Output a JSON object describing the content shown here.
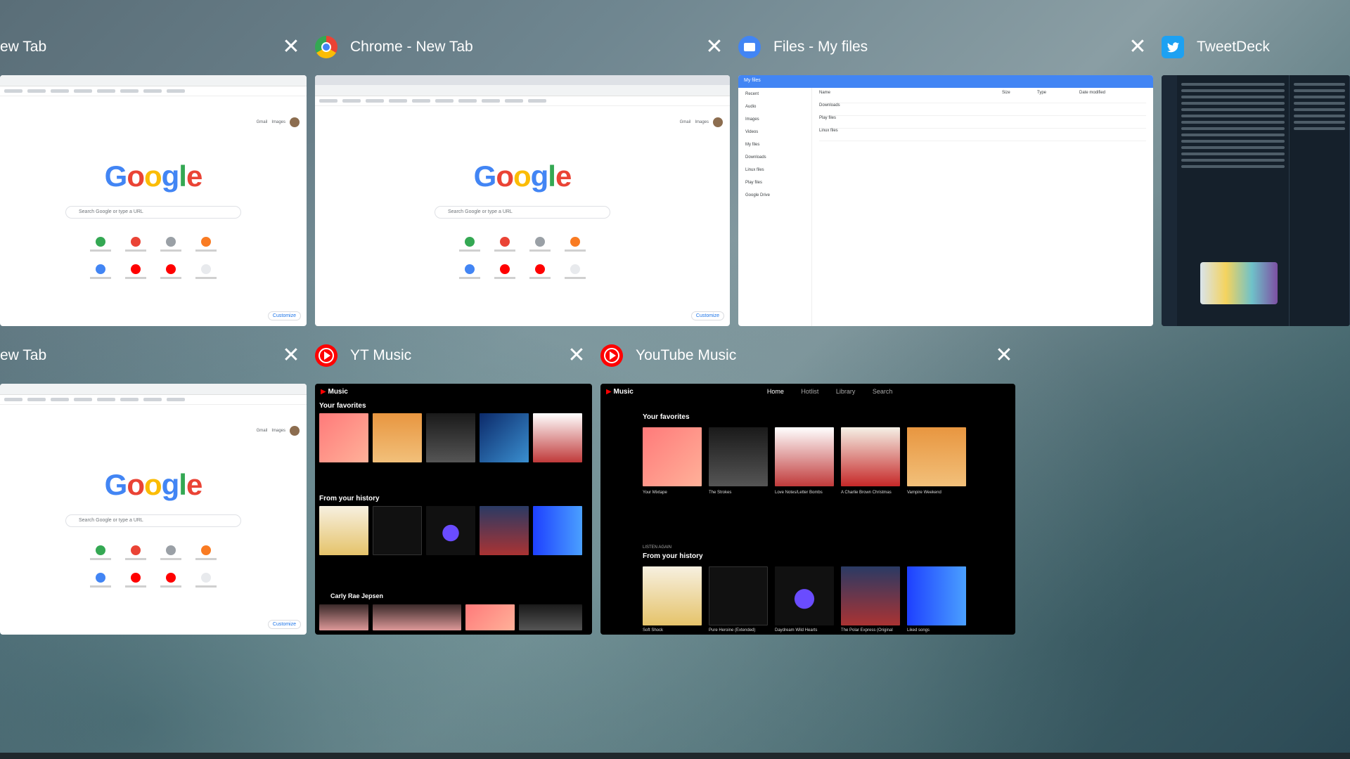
{
  "windows": [
    {
      "title": "ew Tab",
      "app": "chrome"
    },
    {
      "title": "Chrome - New Tab",
      "app": "chrome"
    },
    {
      "title": "Files - My files",
      "app": "files"
    },
    {
      "title": "TweetDeck",
      "app": "tweetdeck"
    },
    {
      "title": "ew Tab",
      "app": "chrome"
    },
    {
      "title": "YT Music",
      "app": "ytmusic"
    },
    {
      "title": "YouTube Music",
      "app": "ytmusic"
    }
  ],
  "close_glyph": "✕",
  "chrome_thumb": {
    "logo": [
      "G",
      "o",
      "o",
      "g",
      "l",
      "e"
    ],
    "search_placeholder": "Search Google or type a URL",
    "top_links": [
      "Gmail",
      "Images"
    ],
    "customize": "Customize"
  },
  "files_thumb": {
    "bar_title": "My files",
    "sidebar": [
      "Recent",
      "Audio",
      "Images",
      "Videos",
      "My files",
      "Downloads",
      "Linux files",
      "Play files",
      "Google Drive"
    ],
    "columns": [
      "Name",
      "Size",
      "Type",
      "Date modified"
    ],
    "rows": [
      "Downloads",
      "Play files",
      "Linux files"
    ]
  },
  "ytm_small": {
    "logo": "Music",
    "favorites_heading": "Your favorites",
    "history_heading": "From your history",
    "artist": "Carly Rae Jepsen"
  },
  "ytm_large": {
    "logo": "Music",
    "nav": [
      "Home",
      "Hotlist",
      "Library",
      "Search"
    ],
    "favorites_heading": "Your favorites",
    "favorites": [
      "Your Mixtape",
      "The Strokes",
      "Love Notes/Letter Bombs",
      "A Charlie Brown Christmas",
      "Vampire Weekend"
    ],
    "listen_again": "LISTEN AGAIN",
    "history_heading": "From your history",
    "history": [
      "Soft Shock",
      "Pure Heroine (Extended)",
      "Daydream Wild Hearts",
      "The Polar Express (Original",
      "Liked songs"
    ]
  },
  "colors": {
    "chrome_red": "#ea4335",
    "files_blue": "#4285f4",
    "twitter_blue": "#1da1f2",
    "youtube_red": "#ff0000"
  }
}
